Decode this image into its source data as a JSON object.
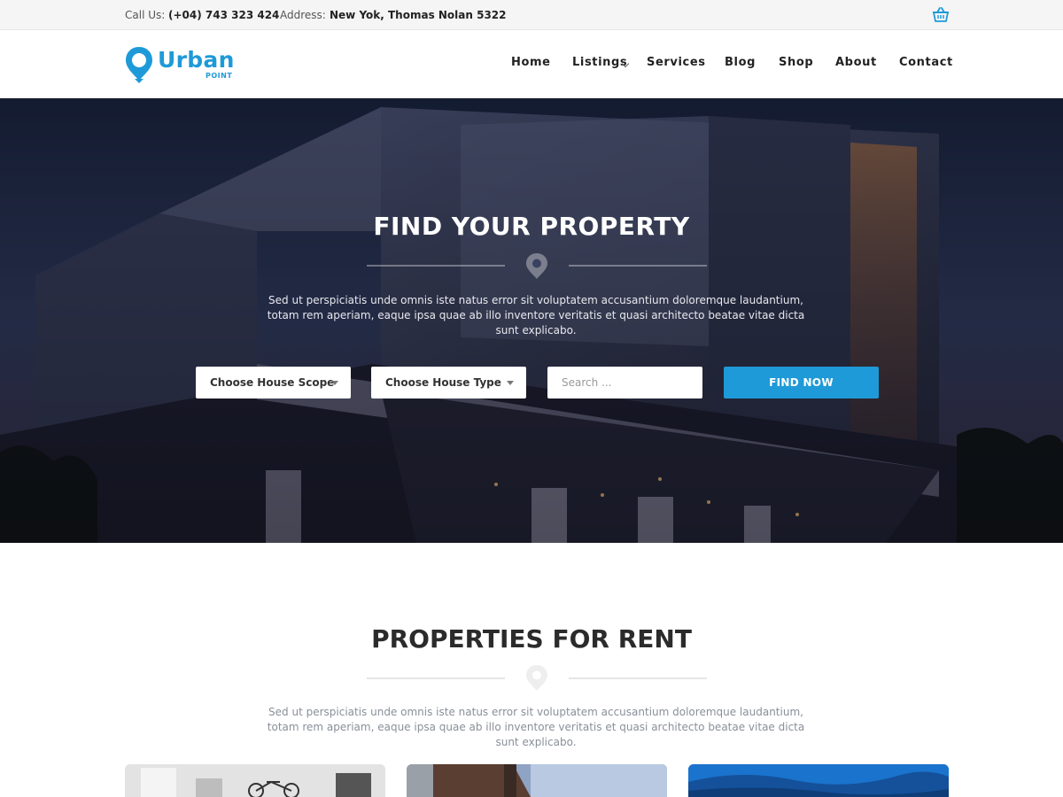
{
  "topbar": {
    "call_label": "Call Us:",
    "call_value": "(+04) 743 323 424",
    "address_label": "Address:",
    "address_value": "New Yok, Thomas Nolan 5322",
    "cart_icon": "basket-icon"
  },
  "header": {
    "logo_main": "Urban",
    "logo_sub": "POINT",
    "nav": [
      {
        "label": "Home"
      },
      {
        "label": "Listings"
      },
      {
        "label": "Services"
      },
      {
        "label": "Blog"
      },
      {
        "label": "Shop"
      },
      {
        "label": "About"
      },
      {
        "label": "Contact"
      }
    ]
  },
  "hero": {
    "title": "FIND YOUR PROPERTY",
    "text": "Sed ut perspiciatis unde omnis iste natus error sit voluptatem accusantium doloremque laudantium, totam rem aperiam, eaque ipsa quae ab illo inventore veritatis et quasi architecto beatae vitae dicta sunt explicabo.",
    "scope_select": "Choose House Scope",
    "type_select": "Choose House Type",
    "search_placeholder": "Search ...",
    "find_button": "FIND NOW"
  },
  "rent": {
    "title": "PROPERTIES FOR RENT",
    "text": "Sed ut perspiciatis unde omnis iste natus error sit voluptatem accusantium doloremque laudantium, totam rem aperiam, eaque ipsa quae ab illo inventore veritatis et quasi architecto beatae vitae dicta sunt explicabo."
  },
  "colors": {
    "accent": "#1e9ad8",
    "topbar_bg": "#f5f5f5",
    "heading": "#2b2b2b",
    "muted_text": "#8a8f99"
  }
}
